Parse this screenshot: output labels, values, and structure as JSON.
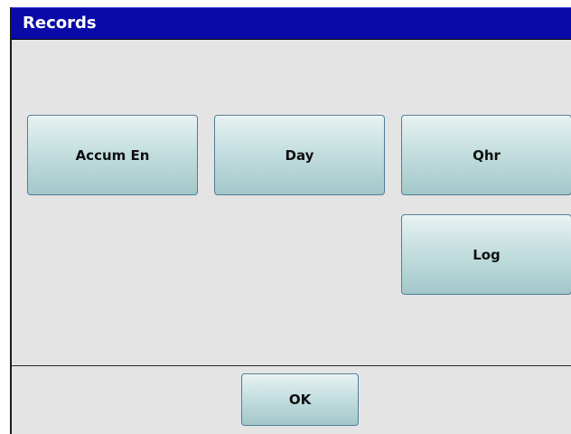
{
  "window": {
    "title": "Records"
  },
  "buttons": {
    "accum_en": "Accum En",
    "day": "Day",
    "qhr": "Qhr",
    "log": "Log",
    "ok": "OK"
  }
}
